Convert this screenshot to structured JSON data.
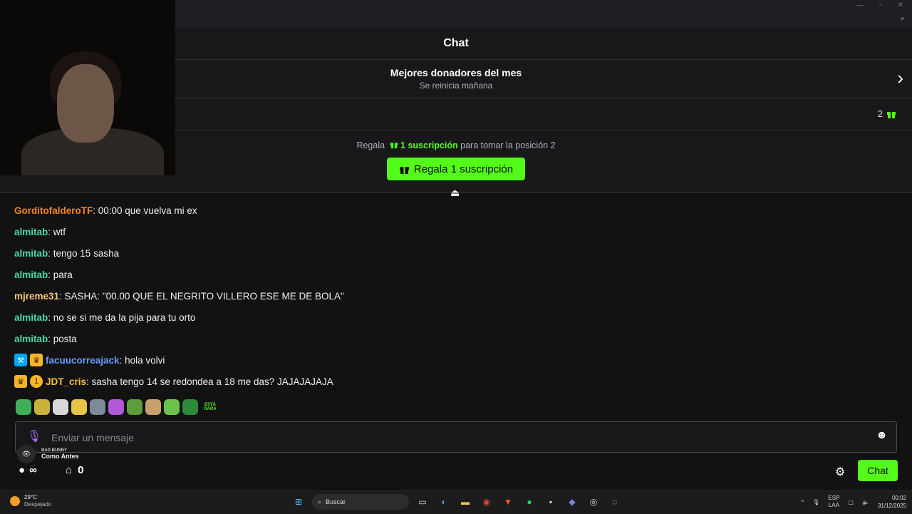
{
  "chat": {
    "title": "Chat"
  },
  "donors": {
    "title": "Mejores donadores del mes",
    "subtitle": "Se reinicia mañana"
  },
  "gift_count": "2",
  "cta": {
    "prefix": "Regala",
    "highlight": "1 suscripción",
    "suffix": "para tomar la posición 2",
    "button": "Regala 1 suscripción"
  },
  "messages": [
    {
      "user": "GorditofalderoTF",
      "color": "#f4861f",
      "text": ": 00:00 que vuelva mi ex",
      "badges": []
    },
    {
      "user": "almitab",
      "color": "#49d9a7",
      "text": ": wtf",
      "badges": []
    },
    {
      "user": "almitab",
      "color": "#49d9a7",
      "text": ": tengo 15 sasha",
      "badges": []
    },
    {
      "user": "almitab",
      "color": "#49d9a7",
      "text": ": para",
      "badges": []
    },
    {
      "user": "mjreme31",
      "color": "#f7c97a",
      "text": ": SASHA: \"00.00 QUE EL NEGRITO VILLERO ESE ME DE BOLA\"",
      "badges": []
    },
    {
      "user": "almitab",
      "color": "#49d9a7",
      "text": ": no se si me da la pija para tu orto",
      "badges": []
    },
    {
      "user": "almitab",
      "color": "#49d9a7",
      "text": ": posta",
      "badges": []
    },
    {
      "user": "facuucorreajack",
      "color": "#6a9bff",
      "text": ": hola volvi",
      "badges": [
        "mod",
        "crown"
      ]
    },
    {
      "user": "JDT_cris",
      "color": "#f8c23a",
      "text": ": sasha tengo 14 se redondea a 18 me das? JAJAJAJAJA",
      "badges": [
        "crown",
        "one"
      ]
    }
  ],
  "emote_label": "ESTÁ RARA",
  "input": {
    "placeholder": "Enviar un mensaje"
  },
  "now_playing": {
    "artist": "BAD BUNNY",
    "song": "Como Antes"
  },
  "points": "∞",
  "store_count": "0",
  "chat_button": "Chat",
  "taskbar": {
    "temp": "29°C",
    "weather": "Despejado",
    "search": "Buscar",
    "lang1": "ESP",
    "lang2": "LAA",
    "time": "00:02",
    "date": "31/12/2025"
  }
}
